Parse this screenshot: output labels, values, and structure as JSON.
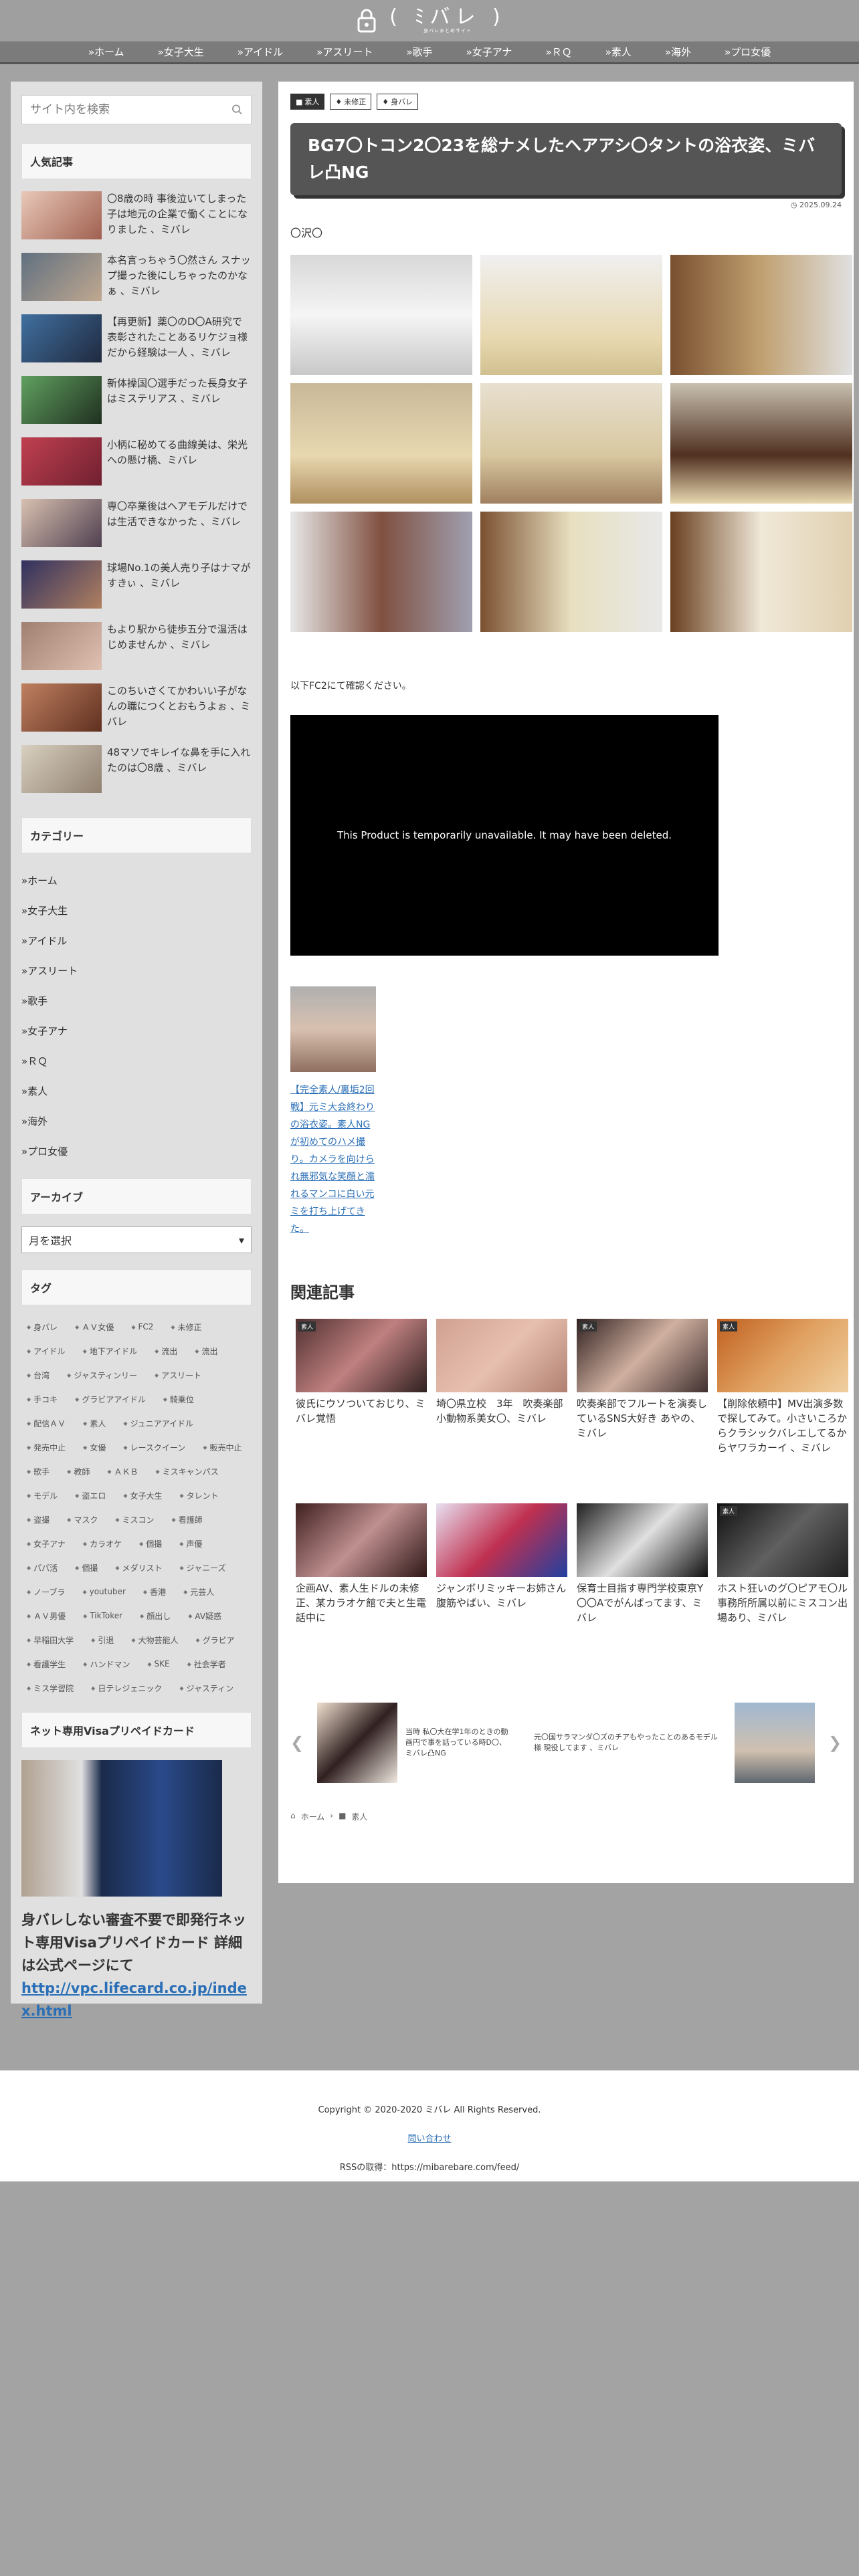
{
  "header": {
    "logo_text": "( ﾐバレ )",
    "logo_sub": "身バレまとめサイト"
  },
  "nav": [
    "»ホーム",
    "»女子大生",
    "»アイドル",
    "»アスリート",
    "»歌手",
    "»女子アナ",
    "»ＲＱ",
    "»素人",
    "»海外",
    "»プロ女優"
  ],
  "sidebar": {
    "search_placeholder": "サイト内を検索",
    "popular_title": "人気記事",
    "popular": [
      "〇8歳の時 事後泣いてしまった子は地元の企業で働くことになりました 、ミバレ",
      "本名言っちゃう〇然さん スナップ撮った後にしちゃったのかなぁ 、ミバレ",
      "【再更新】薬〇のD〇A研究で表彰されたことあるリケジョ様だから経験は一人 、ミバレ",
      "新体操国〇選手だった長身女子はミステリアス 、ミバレ",
      "小柄に秘めてる曲線美は、栄光への懸け橋、ミバレ",
      "専〇卒業後はヘアモデルだけでは生活できなかった 、ミバレ",
      "球場No.1の美人売り子はナマがすきぃ 、ミバレ",
      "もより駅から徒歩五分で温活はじめませんか 、ミバレ",
      "このちいさくてかわいい子がなんの職につくとおもうよぉ 、ミバレ",
      "48マソでキレイな鼻を手に入れたのは〇8歳 、ミバレ"
    ],
    "category_title": "カテゴリー",
    "categories": [
      "»ホーム",
      "»女子大生",
      "»アイドル",
      "»アスリート",
      "»歌手",
      "»女子アナ",
      "»ＲＱ",
      "»素人",
      "»海外",
      "»プロ女優"
    ],
    "archive_title": "アーカイブ",
    "archive_select": "月を選択",
    "tag_title": "タグ",
    "tags": [
      "身バレ",
      "ＡＶ女優",
      "FC2",
      "未修正",
      "アイドル",
      "地下アイドル",
      "流出",
      "流出",
      "台湾",
      "ジャスティンリー",
      "アスリート",
      "手コキ",
      "グラビアアイドル",
      "騎乗位",
      "配信ＡＶ",
      "素人",
      "ジュニアアイドル",
      "発売中止",
      "女優",
      "レースクイーン",
      "販売中止",
      "歌手",
      "教師",
      "ＡＫＢ",
      "ミスキャンパス",
      "モデル",
      "盗エロ",
      "女子大生",
      "タレント",
      "盗撮",
      "マスク",
      "ミスコン",
      "看護師",
      "女子アナ",
      "カラオケ",
      "個撮",
      "声優",
      "パパ活",
      "個撮",
      "メダリスト",
      "ジャニーズ",
      "ノーブラ",
      "youtuber",
      "香港",
      "元芸人",
      "ＡＶ男優",
      "TikToker",
      "顔出し",
      "AV疑惑",
      "早稲田大学",
      "引退",
      "大物芸能人",
      "グラビア",
      "看護学生",
      "ハンドマン",
      "SKE",
      "社会学者",
      "ミス学習院",
      "日テレジェニック",
      "ジャスティン"
    ],
    "visa_title": "ネット専用Visaプリペイドカード",
    "visa_text": "身バレしない審査不要で即発行ネット専用Visaプリペイドカード 詳細は公式ページにて",
    "visa_link": "http://vpc.lifecard.co.jp/index.html"
  },
  "article": {
    "badges": [
      "素人",
      "未修正",
      "身バレ"
    ],
    "title": "BG7〇トコン2〇23を総ナメしたヘアアシ〇タントの浴衣姿、ミバレ凸NG",
    "date": "2025.09.24",
    "intro": "〇沢〇",
    "note": "以下FC2にて確認ください。",
    "video_message": "This Product is temporarily unavailable. It may have been deleted.",
    "ad_link": "【完全素人/裏垢2回戦】元ミ大会終わりの浴衣姿。素人NGが初めてのハメ撮り。カメラを向けられ無邪気な笑顔と濡れるマンコに白い元ミを打ち上げてきた。",
    "related_title": "関連記事",
    "related": [
      {
        "cat": "素人",
        "text": "彼氏にウソついておじり、ミバレ覚悟"
      },
      {
        "cat": "",
        "text": "埼〇県立校　3年　吹奏楽部　小動物系美女〇、ミバレ"
      },
      {
        "cat": "素人",
        "text": "吹奏楽部でフルートを演奏しているSNS大好き あやの、ミバレ"
      },
      {
        "cat": "素人",
        "text": "【削除依頼中】MV出演多数で探してみて。小さいころからクラシックバレエしてるからヤワラカーイ 、ミバレ"
      },
      {
        "cat": "",
        "text": "企画AV、素人生ドルの未修正、某カラオケ館で夫と生電話中に"
      },
      {
        "cat": "",
        "text": "ジャンボリミッキーお姉さん 腹筋やばい、ミバレ"
      },
      {
        "cat": "",
        "text": "保育士目指す専門学校東京Y〇〇Aでがんばってます、ミバレ"
      },
      {
        "cat": "素人",
        "text": "ホスト狂いのグ〇ピアモ〇ル 事務所所属以前にミスコン出場あり、ミバレ"
      }
    ],
    "carousel": [
      "当時 私〇大在学1年のときの動画円で事を話っている時D〇、ミバレ凸NG",
      "元〇国サラマンダ〇ズのチアもやったことのあるモデル様 現役してます 、ミバレ"
    ],
    "breadcrumb": [
      "ホーム",
      "素人"
    ]
  },
  "footer": {
    "copyright": "Copyright © 2020-2020 ミバレ All Rights Reserved.",
    "contact": "問い合わせ",
    "rss": "RSSの取得：https://mibarebare.com/feed/"
  }
}
